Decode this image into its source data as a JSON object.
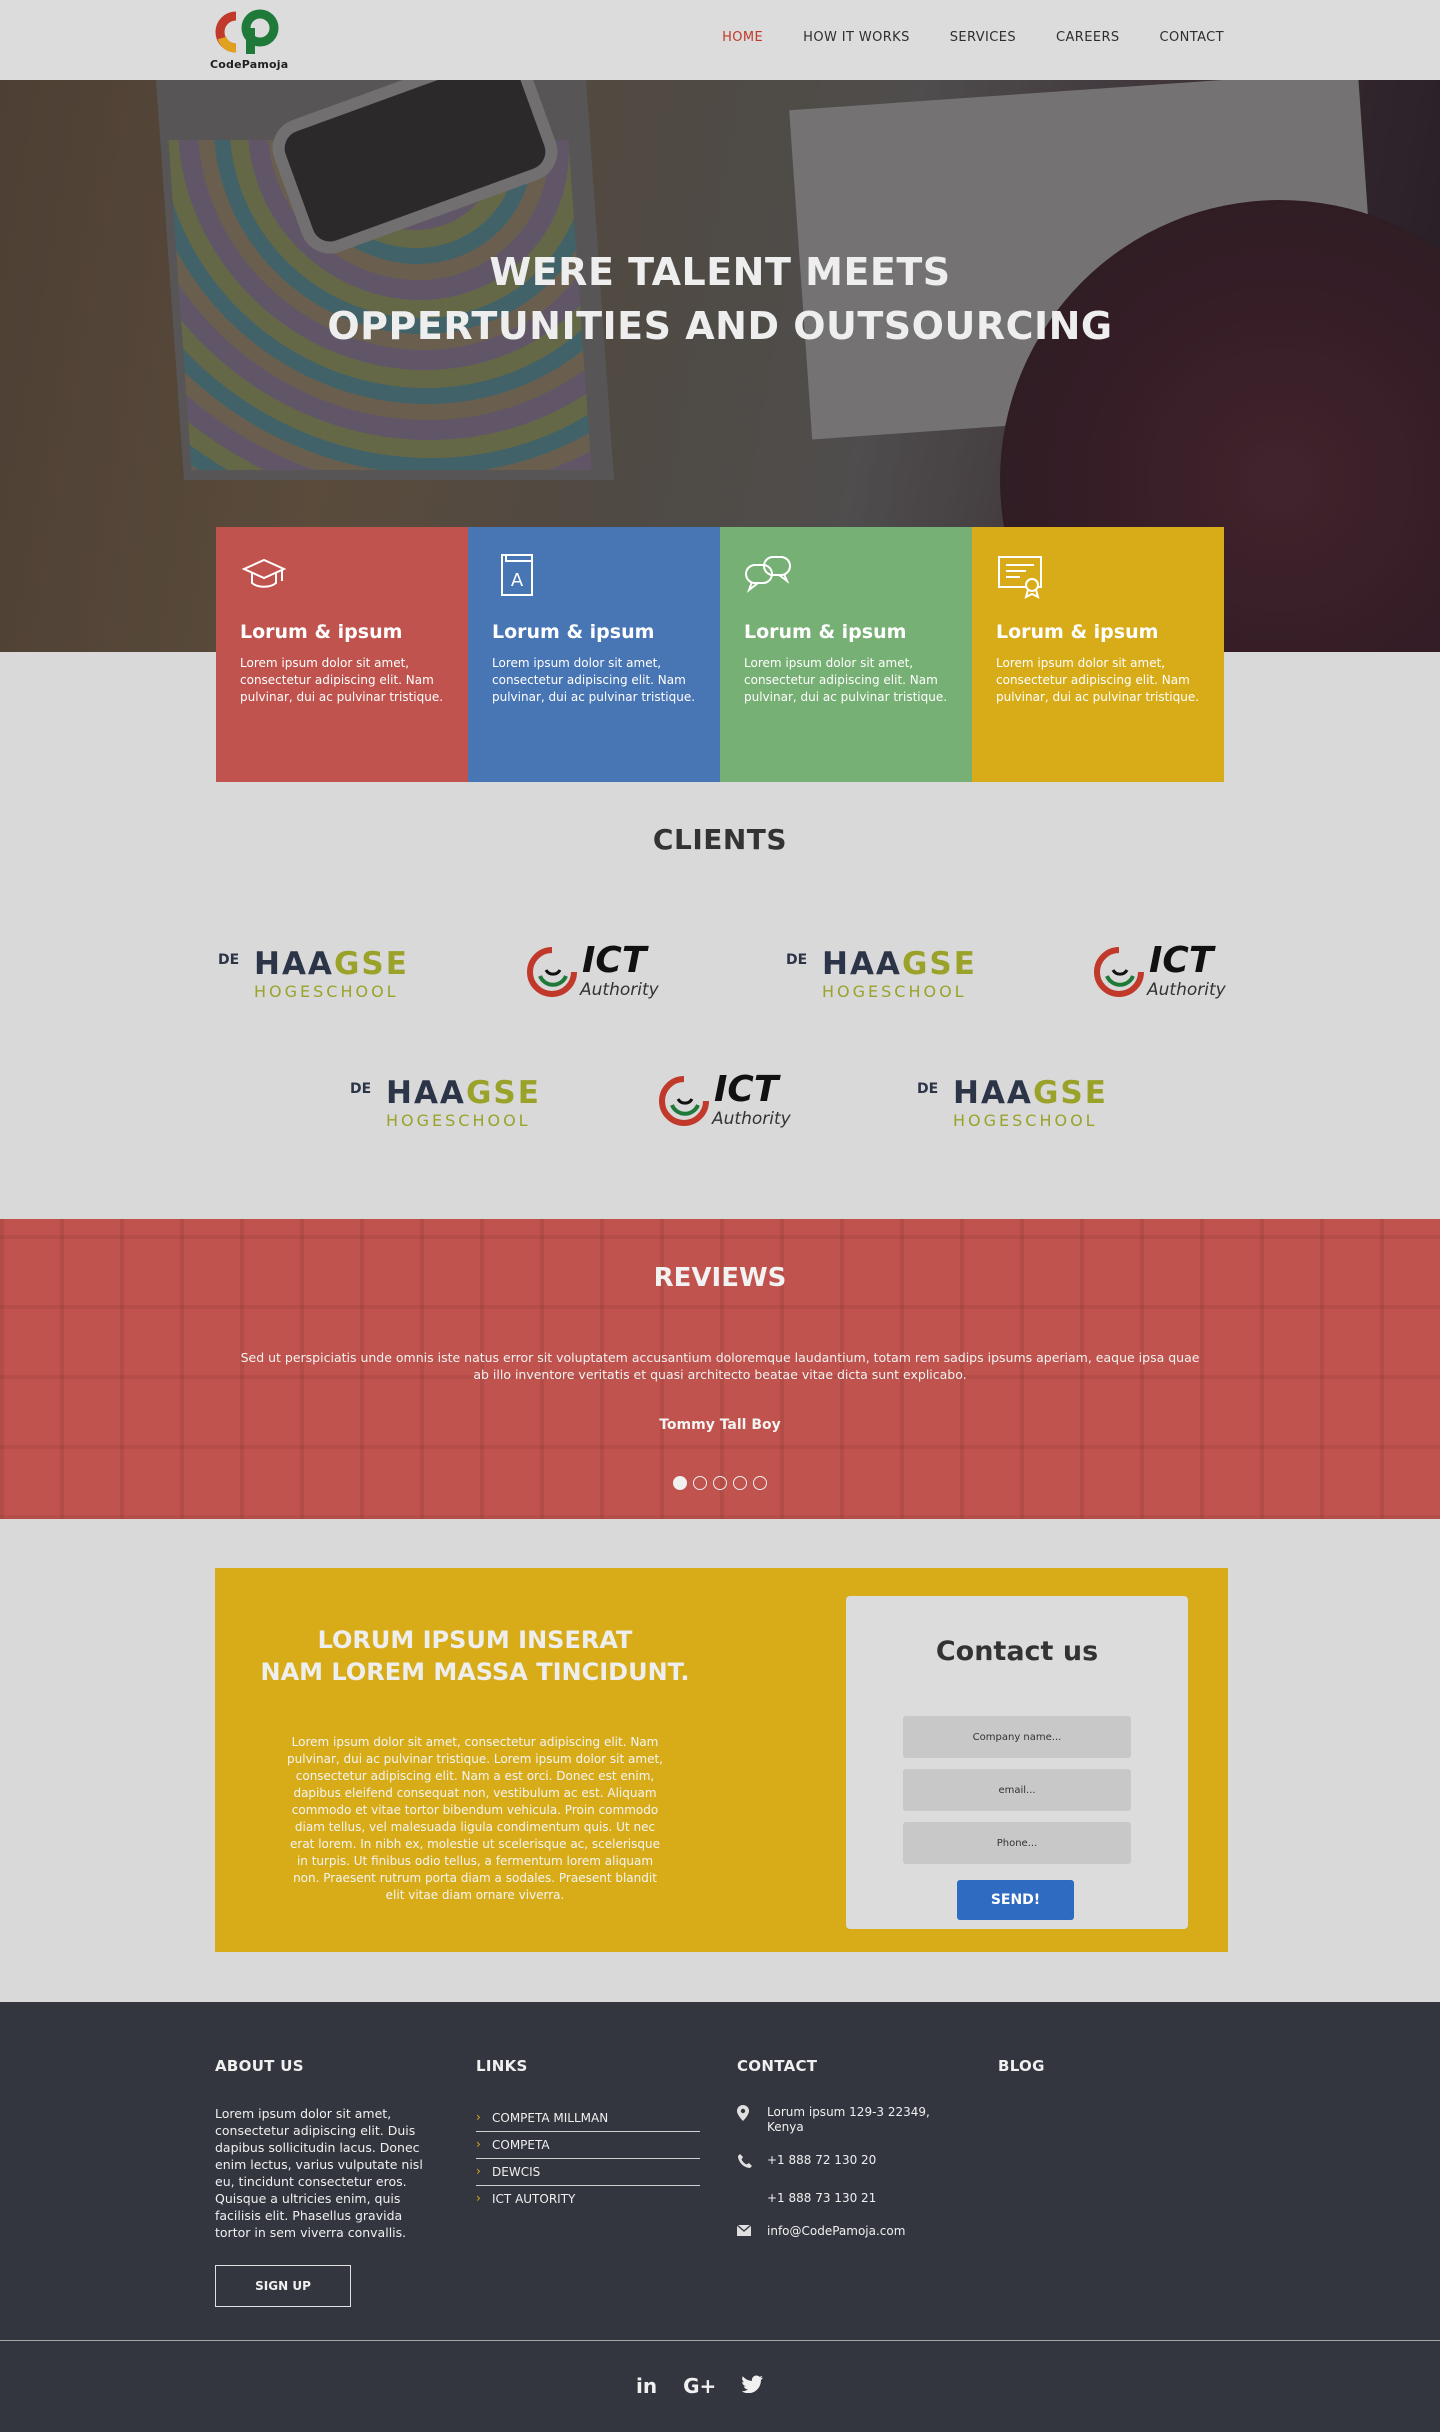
{
  "brand": {
    "name": "CodePamoja"
  },
  "nav": {
    "items": [
      "HOME",
      "HOW IT WORKS",
      "SERVICES",
      "CAREERS",
      "CONTACT"
    ],
    "active": "HOME",
    "active_color": "#c0392b"
  },
  "hero": {
    "title_line1": "WERE TALENT MEETS",
    "title_line2": "OPPERTUNITIES AND OUTSOURCING"
  },
  "features": [
    {
      "title": "Lorum & ipsum",
      "text": "Lorem ipsum dolor sit amet, consectetur adipiscing elit. Nam pulvinar, dui ac pulvinar tristique.",
      "color": "#c0534d",
      "icon": "graduation-cap-icon"
    },
    {
      "title": "Lorum & ipsum",
      "text": "Lorem ipsum dolor sit amet, consectetur adipiscing elit. Nam pulvinar, dui ac pulvinar tristique.",
      "color": "#4876b5",
      "icon": "book-icon"
    },
    {
      "title": "Lorum & ipsum",
      "text": "Lorem ipsum dolor sit amet, consectetur adipiscing elit. Nam pulvinar, dui ac pulvinar tristique.",
      "color": "#77b074",
      "icon": "chat-bubbles-icon"
    },
    {
      "title": "Lorum & ipsum",
      "text": "Lorem ipsum dolor sit amet, consectetur adipiscing elit. Nam pulvinar, dui ac pulvinar tristique.",
      "color": "#d8ac18",
      "icon": "certificate-icon"
    }
  ],
  "clients": {
    "title": "CLIENTS",
    "haagse": {
      "de": "DE",
      "haagse": "HAAGSE",
      "hogeschool": "HOGESCHOOL"
    },
    "ict": {
      "ict": "ICT",
      "authority": "Authority"
    }
  },
  "reviews": {
    "title": "REVIEWS",
    "quote": "Sed ut perspiciatis unde omnis iste natus error sit voluptatem accusantium doloremque laudantium, totam rem sadips ipsums aperiam, eaque ipsa quae ab illo inventore veritatis et quasi architecto beatae vitae dicta sunt explicabo.",
    "author": "Tommy Tall Boy",
    "slide_count": 5,
    "active_slide": 1
  },
  "cta": {
    "heading_line1": "LORUM IPSUM INSERAT",
    "heading_line2": "NAM LOREM MASSA TINCIDUNT.",
    "body": "Lorem ipsum dolor sit amet, consectetur adipiscing elit. Nam pulvinar, dui ac pulvinar tristique. Lorem ipsum dolor sit amet, consectetur adipiscing elit. Nam a est orci. Donec est enim, dapibus eleifend consequat non, vestibulum ac est. Aliquam commodo et vitae tortor bibendum vehicula. Proin commodo diam tellus, vel malesuada ligula condimentum quis. Ut nec erat lorem. In nibh ex, molestie ut scelerisque ac, scelerisque in turpis. Ut finibus odio tellus, a fermentum lorem aliquam non. Praesent rutrum porta diam a sodales. Praesent blandit elit vitae diam ornare viverra."
  },
  "contact_form": {
    "title": "Contact us",
    "company_placeholder": "Company name...",
    "email_placeholder": "email...",
    "phone_placeholder": "Phone...",
    "send_label": "SEND!"
  },
  "footer": {
    "about": {
      "title": "ABOUT US",
      "text": "Lorem ipsum dolor sit amet, consectetur adipiscing elit. Duis dapibus sollicitudin lacus. Donec enim lectus, varius vulputate nisl eu, tincidunt consectetur eros. Quisque a ultricies enim, quis facilisis elit. Phasellus gravida tortor in sem viverra convallis.",
      "signup_label": "SIGN UP"
    },
    "links": {
      "title": "LINKS",
      "items": [
        "COMPETA MILLMAN",
        "COMPETA",
        "DEWCIS",
        "ICT AUTORITY"
      ]
    },
    "contact": {
      "title": "CONTACT",
      "address": "Lorum ipsum  129-3 22349, Kenya",
      "phone1": "+1 888 72 130 20",
      "phone2": "+1 888 73 130 21",
      "email": "info@CodePamoja.com"
    },
    "blog": {
      "title": "BLOG"
    },
    "social": [
      "in",
      "G+",
      "twitter-icon"
    ]
  }
}
